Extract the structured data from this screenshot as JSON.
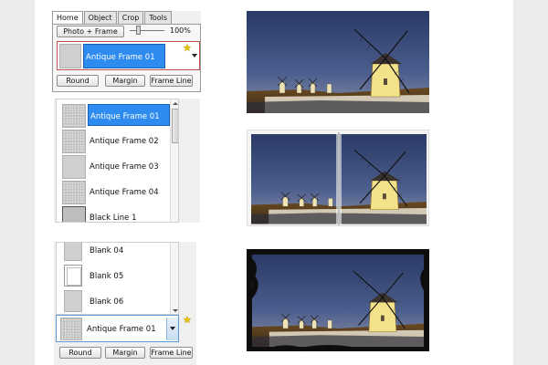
{
  "ribbon": {
    "tabs": [
      "Home",
      "Object",
      "Crop",
      "Tools"
    ],
    "active_tab": "Home",
    "photo_frame_button": "Photo + Frame",
    "zoom": "100%",
    "selected_frame": "Antique Frame 01",
    "buttons": {
      "round": "Round",
      "margin": "Margin",
      "frame_line": "Frame Line"
    }
  },
  "frame_list_top": {
    "items": [
      "Antique Frame 01",
      "Antique Frame 02",
      "Antique Frame 03",
      "Antique Frame 04",
      "Black Line 1"
    ],
    "selected": "Antique Frame 01"
  },
  "frame_list_bottom": {
    "items": [
      "Blank 04",
      "Blank 05",
      "Blank 06"
    ],
    "selected": "Antique Frame 01",
    "buttons": {
      "round": "Round",
      "margin": "Margin",
      "frame_line": "Frame Line"
    }
  },
  "previews": [
    "plain photo",
    "book spread frame",
    "antique grunge frame"
  ],
  "colors": {
    "selection": "#2e8bf0",
    "star": "#e7c200",
    "sky": "#3a4a75",
    "windmill": "#f2e28a"
  }
}
